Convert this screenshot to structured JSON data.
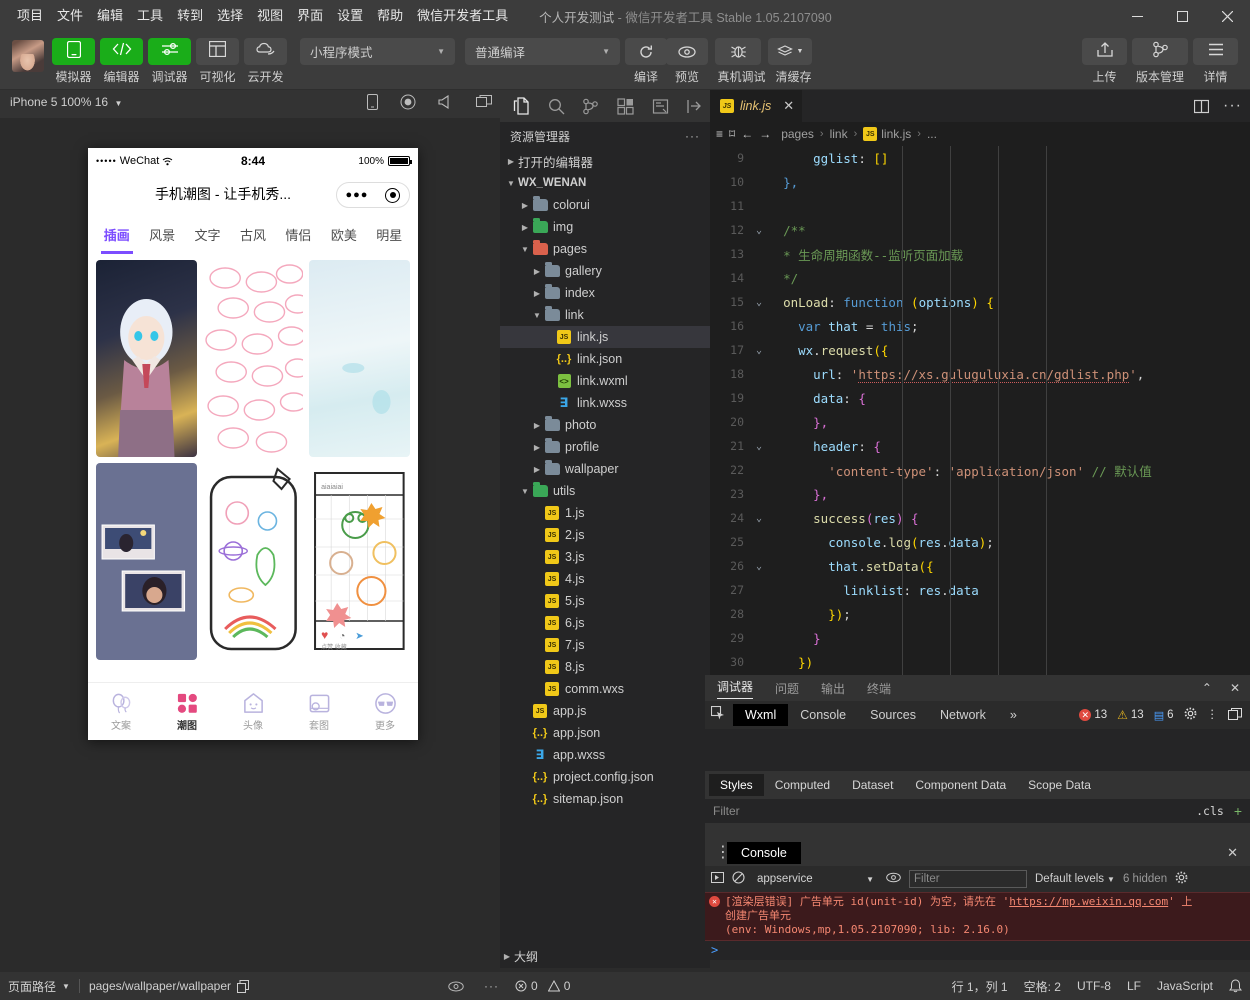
{
  "titlebar": {
    "menus": [
      "项目",
      "文件",
      "编辑",
      "工具",
      "转到",
      "选择",
      "视图",
      "界面",
      "设置",
      "帮助",
      "微信开发者工具"
    ],
    "project_name": "个人开发测试",
    "separator": "-",
    "app_name": "微信开发者工具",
    "version": "Stable 1.05.2107090",
    "window_buttons": {
      "minimize": "—",
      "maximize": "▢",
      "close": "✕"
    }
  },
  "toolbar": {
    "left_buttons": [
      {
        "label": "模拟器",
        "icon": "phone-icon",
        "green": true
      },
      {
        "label": "编辑器",
        "icon": "code-icon",
        "green": true
      },
      {
        "label": "调试器",
        "icon": "sliders-icon",
        "green": true
      },
      {
        "label": "可视化",
        "icon": "layout-icon",
        "green": false
      },
      {
        "label": "云开发",
        "icon": "cloud-icon",
        "green": false
      }
    ],
    "mode_select": "小程序模式",
    "compile_select": "普通编译",
    "compile_label": "编译",
    "preview_label": "预览",
    "realdevice_label": "真机调试",
    "clearcache_label": "清缓存",
    "right_buttons": [
      {
        "label": "上传",
        "icon": "upload-icon"
      },
      {
        "label": "版本管理",
        "icon": "branch-icon"
      },
      {
        "label": "详情",
        "icon": "menu-icon"
      }
    ]
  },
  "simulator": {
    "device_label": "iPhone 5 100% 16",
    "phone": {
      "carrier": "WeChat",
      "signal_dots": "•••••",
      "time": "8:44",
      "battery_pct": "100%",
      "nav_title": "手机潮图 - 让手机秀...",
      "categories": [
        "插画",
        "风景",
        "文字",
        "古风",
        "情侣",
        "欧美",
        "明星"
      ],
      "active_category": "插画",
      "accent_color": "#7c4dff",
      "tabbar": [
        {
          "label": "文案",
          "icon": "balloon-icon",
          "active": false
        },
        {
          "label": "潮图",
          "icon": "grid-icon",
          "active": true
        },
        {
          "label": "头像",
          "icon": "ghost-icon",
          "active": false
        },
        {
          "label": "套图",
          "icon": "album-icon",
          "active": false
        },
        {
          "label": "更多",
          "icon": "sunglasses-icon",
          "active": false
        }
      ]
    }
  },
  "explorer": {
    "activity_icons": [
      "files-icon",
      "search-icon",
      "source-control-icon",
      "extensions-icon",
      "test-icon",
      "collapse-icon"
    ],
    "title": "资源管理器",
    "more": "···",
    "sections": [
      {
        "label": "打开的编辑器",
        "expanded": false,
        "depth": 0,
        "kind": "section"
      },
      {
        "label": "WX_WENAN",
        "expanded": true,
        "depth": 0,
        "kind": "root"
      }
    ],
    "tree": [
      {
        "label": "colorui",
        "kind": "folder",
        "depth": 1,
        "expanded": false
      },
      {
        "label": "img",
        "kind": "folder-green",
        "depth": 1,
        "expanded": false
      },
      {
        "label": "pages",
        "kind": "folder-red",
        "depth": 1,
        "expanded": true
      },
      {
        "label": "gallery",
        "kind": "folder",
        "depth": 2,
        "expanded": false
      },
      {
        "label": "index",
        "kind": "folder",
        "depth": 2,
        "expanded": false
      },
      {
        "label": "link",
        "kind": "folder",
        "depth": 2,
        "expanded": true
      },
      {
        "label": "link.js",
        "kind": "js",
        "depth": 3,
        "selected": true
      },
      {
        "label": "link.json",
        "kind": "json",
        "depth": 3
      },
      {
        "label": "link.wxml",
        "kind": "wxml",
        "depth": 3
      },
      {
        "label": "link.wxss",
        "kind": "wxss",
        "depth": 3
      },
      {
        "label": "photo",
        "kind": "folder",
        "depth": 2,
        "expanded": false
      },
      {
        "label": "profile",
        "kind": "folder",
        "depth": 2,
        "expanded": false
      },
      {
        "label": "wallpaper",
        "kind": "folder",
        "depth": 2,
        "expanded": false
      },
      {
        "label": "utils",
        "kind": "folder-green",
        "depth": 1,
        "expanded": true
      },
      {
        "label": "1.js",
        "kind": "js",
        "depth": 2
      },
      {
        "label": "2.js",
        "kind": "js",
        "depth": 2
      },
      {
        "label": "3.js",
        "kind": "js",
        "depth": 2
      },
      {
        "label": "4.js",
        "kind": "js",
        "depth": 2
      },
      {
        "label": "5.js",
        "kind": "js",
        "depth": 2
      },
      {
        "label": "6.js",
        "kind": "js",
        "depth": 2
      },
      {
        "label": "7.js",
        "kind": "js",
        "depth": 2
      },
      {
        "label": "8.js",
        "kind": "js",
        "depth": 2
      },
      {
        "label": "comm.wxs",
        "kind": "js",
        "depth": 2
      },
      {
        "label": "app.js",
        "kind": "js",
        "depth": 1
      },
      {
        "label": "app.json",
        "kind": "json",
        "depth": 1
      },
      {
        "label": "app.wxss",
        "kind": "wxss",
        "depth": 1
      },
      {
        "label": "project.config.json",
        "kind": "json",
        "depth": 1
      },
      {
        "label": "sitemap.json",
        "kind": "json",
        "depth": 1
      }
    ],
    "outline_label": "大纲"
  },
  "editor": {
    "tab_label": "link.js",
    "tab_close": "✕",
    "split_icon": "split-editor-icon",
    "more_icon": "more-icon",
    "breadcrumb": [
      "pages",
      "link",
      "link.js",
      "..."
    ],
    "lines": [
      {
        "n": "9",
        "fold": "",
        "html": "      <span class='k-var'>gglist</span><span class='k-pln'>: </span><span class='k-br'>[]</span>"
      },
      {
        "n": "10",
        "fold": "",
        "html": "  <span class='k-ctl'>},</span>"
      },
      {
        "n": "11",
        "fold": "",
        "html": ""
      },
      {
        "n": "12",
        "fold": "⌄",
        "html": "  <span class='k-cmt'>/**</span>"
      },
      {
        "n": "13",
        "fold": "",
        "html": "  <span class='k-cmt'>* 生命周期函数--监听页面加载</span>"
      },
      {
        "n": "14",
        "fold": "",
        "html": "  <span class='k-cmt'>*/</span>"
      },
      {
        "n": "15",
        "fold": "⌄",
        "html": "  <span class='k-prop'>onLoad</span><span class='k-pln'>: </span><span class='k-ctl'>function</span> <span class='k-br'>(</span><span class='k-var'>options</span><span class='k-br'>)</span> <span class='k-br'>{</span>"
      },
      {
        "n": "16",
        "fold": "",
        "html": "    <span class='k-ctl'>var</span> <span class='k-var'>that</span> <span class='k-pln'>=</span> <span class='k-ctl'>this</span><span class='k-pln'>;</span>"
      },
      {
        "n": "17",
        "fold": "⌄",
        "html": "    <span class='k-var'>wx</span><span class='k-pln'>.</span><span class='k-prop'>request</span><span class='k-br'>({</span>"
      },
      {
        "n": "18",
        "fold": "",
        "html": "      <span class='k-var'>url</span><span class='k-pln'>: </span><span class='k-str'>'</span><span class='k-url'>https://xs.guluguluxia.cn/gdlist.php</span><span class='k-str'>'</span><span class='k-pln'>,</span>"
      },
      {
        "n": "19",
        "fold": "",
        "html": "      <span class='k-var'>data</span><span class='k-pln'>: </span><span class='k-br2'>{</span>"
      },
      {
        "n": "20",
        "fold": "",
        "html": "      <span class='k-br2'>},</span>"
      },
      {
        "n": "21",
        "fold": "⌄",
        "html": "      <span class='k-var'>header</span><span class='k-pln'>: </span><span class='k-br2'>{</span>"
      },
      {
        "n": "22",
        "fold": "",
        "html": "        <span class='k-str'>'content-type'</span><span class='k-pln'>: </span><span class='k-str'>'application/json'</span> <span class='k-cmt'>// 默认值</span>"
      },
      {
        "n": "23",
        "fold": "",
        "html": "      <span class='k-br2'>},</span>"
      },
      {
        "n": "24",
        "fold": "⌄",
        "html": "      <span class='k-prop'>success</span><span class='k-br2'>(</span><span class='k-var'>res</span><span class='k-br2'>)</span> <span class='k-br2'>{</span>"
      },
      {
        "n": "25",
        "fold": "",
        "html": "        <span class='k-var'>console</span><span class='k-pln'>.</span><span class='k-prop'>log</span><span class='k-br'>(</span><span class='k-var'>res</span><span class='k-pln'>.</span><span class='k-var'>data</span><span class='k-br'>)</span><span class='k-pln'>;</span>"
      },
      {
        "n": "26",
        "fold": "⌄",
        "html": "        <span class='k-var'>that</span><span class='k-pln'>.</span><span class='k-prop'>setData</span><span class='k-br'>({</span>"
      },
      {
        "n": "27",
        "fold": "",
        "html": "          <span class='k-var'>linklist</span><span class='k-pln'>: </span><span class='k-var'>res</span><span class='k-pln'>.</span><span class='k-var'>data</span>"
      },
      {
        "n": "28",
        "fold": "",
        "html": "        <span class='k-br'>})</span><span class='k-pln'>;</span>"
      },
      {
        "n": "29",
        "fold": "",
        "html": "      <span class='k-br2'>}</span>"
      },
      {
        "n": "30",
        "fold": "",
        "html": "    <span class='k-br'>})</span>"
      }
    ]
  },
  "debugger": {
    "panel_tabs": [
      "调试器",
      "问题",
      "输出",
      "终端"
    ],
    "active_panel_tab": "调试器",
    "collapse_icon": "chevron-up-icon",
    "close_icon": "close-icon",
    "inspect_icon": "inspect-icon",
    "devtabs": [
      "Wxml",
      "Console",
      "Sources",
      "Network"
    ],
    "active_devtab": "Wxml",
    "overflow": "»",
    "errors": "13",
    "warnings": "13",
    "infos": "6",
    "gear_icon": "gear-icon",
    "kebab_icon": "kebab-icon",
    "dock_icon": "dock-icon",
    "style_tabs": [
      "Styles",
      "Computed",
      "Dataset",
      "Component Data",
      "Scope Data"
    ],
    "active_style_tab": "Styles",
    "filter_placeholder": "Filter",
    "cls_label": ".cls",
    "plus_label": "+"
  },
  "console": {
    "title": "Console",
    "close": "✕",
    "kebab": "⋮",
    "run_icon": "run-icon",
    "clear_icon": "clear-icon",
    "context": "appservice",
    "eye_icon": "eye-icon",
    "filter_placeholder": "Filter",
    "levels": "Default levels",
    "hidden_count": "6 hidden",
    "gear_icon": "gear-icon",
    "error_line1_a": "[渲染层错误] 广告单元 id(unit-id) 为空，请先在 '",
    "error_link": "https://mp.weixin.qq.com",
    "error_line1_b": "' 上",
    "error_line2": "创建广告单元",
    "error_line3": "(env: Windows,mp,1.05.2107090; lib: 2.16.0)",
    "prompt": ">"
  },
  "statusbar": {
    "page_path_label": "页面路径",
    "page_path_value": "pages/wallpaper/wallpaper",
    "copy_icon": "copy-icon",
    "eye_icon": "eye-icon",
    "more_icon": "more-icon",
    "error_count": "0",
    "warning_count": "0",
    "line_col": "行 1，列 1",
    "spaces": "空格: 2",
    "encoding": "UTF-8",
    "eol": "LF",
    "language": "JavaScript",
    "bell_icon": "bell-icon"
  }
}
